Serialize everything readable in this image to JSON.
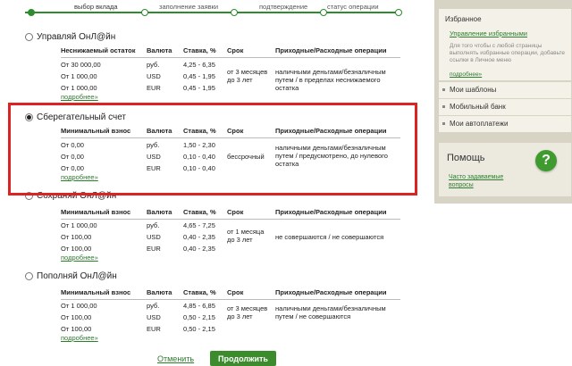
{
  "steps": [
    {
      "label": "выбор вклада",
      "active": true
    },
    {
      "label": "заполнение заявки",
      "active": false
    },
    {
      "label": "подтверждение",
      "active": false
    },
    {
      "label": "статус операции",
      "active": false
    }
  ],
  "deposits": [
    {
      "title": "Управляй ОнЛ@йн",
      "selected": false,
      "headers": [
        "Неснижаемый остаток",
        "Валюта",
        "Ставка, %",
        "Срок",
        "Приходные/Расходные операции"
      ],
      "rows": [
        {
          "amount": "От 30 000,00",
          "currency": "руб.",
          "rate": "4,25 - 6,35"
        },
        {
          "amount": "От 1 000,00",
          "currency": "USD",
          "rate": "0,45 - 1,95"
        },
        {
          "amount": "От 1 000,00",
          "currency": "EUR",
          "rate": "0,45 - 1,95"
        }
      ],
      "term": "от 3 месяцев до 3 лет",
      "operations": "наличными деньгами/безналичным путем / в пределах неснижаемого остатка",
      "more": "подробнее»"
    },
    {
      "title": "Сберегательный счет",
      "selected": true,
      "headers": [
        "Минимальный взнос",
        "Валюта",
        "Ставка, %",
        "Срок",
        "Приходные/Расходные операции"
      ],
      "rows": [
        {
          "amount": "От 0,00",
          "currency": "руб.",
          "rate": "1,50 - 2,30"
        },
        {
          "amount": "От 0,00",
          "currency": "USD",
          "rate": "0,10 - 0,40"
        },
        {
          "amount": "От 0,00",
          "currency": "EUR",
          "rate": "0,10 - 0,40"
        }
      ],
      "term": "бессрочный",
      "operations": "наличными деньгами/безналичным путем / предусмотрено, до нулевого остатка",
      "more": "подробнее»"
    },
    {
      "title": "Сохраняй ОнЛ@йн",
      "selected": false,
      "headers": [
        "Минимальный взнос",
        "Валюта",
        "Ставка, %",
        "Срок",
        "Приходные/Расходные операции"
      ],
      "rows": [
        {
          "amount": "От 1 000,00",
          "currency": "руб.",
          "rate": "4,65 - 7,25"
        },
        {
          "amount": "От 100,00",
          "currency": "USD",
          "rate": "0,40 - 2,35"
        },
        {
          "amount": "От 100,00",
          "currency": "EUR",
          "rate": "0,40 - 2,35"
        }
      ],
      "term": "от 1 месяца до 3 лет",
      "operations": "не совершаются / не совершаются",
      "more": "подробнее»"
    },
    {
      "title": "Пополняй ОнЛ@йн",
      "selected": false,
      "headers": [
        "Минимальный взнос",
        "Валюта",
        "Ставка, %",
        "Срок",
        "Приходные/Расходные операции"
      ],
      "rows": [
        {
          "amount": "От 1 000,00",
          "currency": "руб.",
          "rate": "4,85 - 6,85"
        },
        {
          "amount": "От 100,00",
          "currency": "USD",
          "rate": "0,50 - 2,15"
        },
        {
          "amount": "От 100,00",
          "currency": "EUR",
          "rate": "0,50 - 2,15"
        }
      ],
      "term": "от 3 месяцев до 3 лет",
      "operations": "наличными деньгами/безналичным путем / не совершаются",
      "more": "подробнее»"
    }
  ],
  "actions": {
    "cancel": "Отменить",
    "continue": "Продолжить"
  },
  "sidebar": {
    "favorites_title": "Избранное",
    "favorites_link": "Управление избранными",
    "favorites_desc": "Для того чтобы с любой страницы выполнять избранные операции, добавьте ссылки в Личное меню",
    "favorites_more": "подробнее»",
    "items": [
      "Мои шаблоны",
      "Мобильный банк",
      "Мои автоплатежи"
    ],
    "help_title": "Помощь",
    "help_link": "Часто задаваемые вопросы"
  },
  "colors": {
    "accent": "#2e8b2e",
    "highlight": "#dd2222",
    "button": "#3c8c2e"
  }
}
